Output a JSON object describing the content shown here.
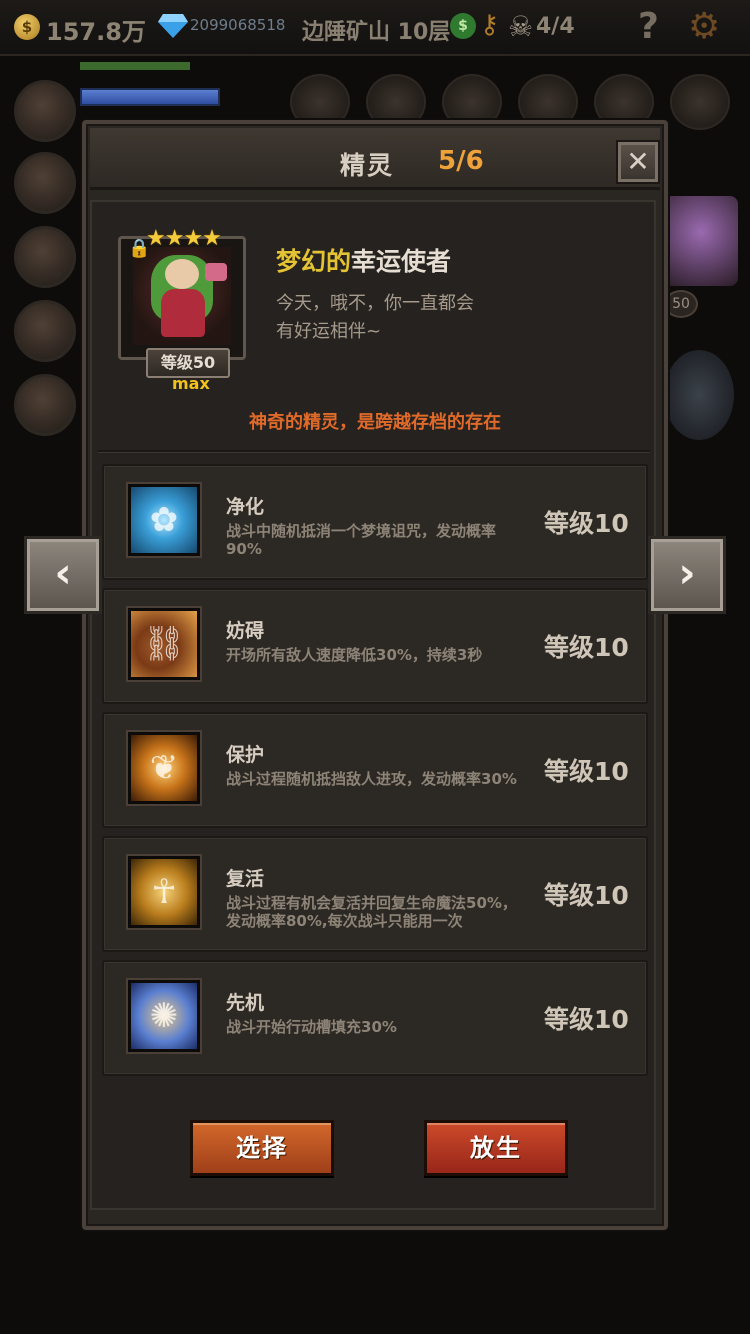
{
  "topbar": {
    "gold": "157.8万",
    "gold_icon": "$",
    "gems": "2099068518",
    "location": "边陲矿山 10层",
    "badge": "$",
    "kills": "4/4",
    "help": "?"
  },
  "background": {
    "side_level": "50"
  },
  "dialog": {
    "title": "精灵",
    "count": "5/6",
    "close": "✕"
  },
  "pet": {
    "stars": "★★★★",
    "level": "等级50",
    "max": "max",
    "name_part1": "梦幻的",
    "name_part2": "幸运使者",
    "desc_line1": "今天，哦不，你一直都会",
    "desc_line2": "有好运相伴~",
    "note": "神奇的精灵，是跨越存档的存在"
  },
  "skills": [
    {
      "name": "净化",
      "desc": "战斗中随机抵消一个梦境诅咒，发动概率90%",
      "level": "等级10",
      "icon": "flower-icon"
    },
    {
      "name": "妨碍",
      "desc": "开场所有敌人速度降低30%，持续3秒",
      "level": "等级10",
      "icon": "chained-boot-icon"
    },
    {
      "name": "保护",
      "desc": "战斗过程随机抵挡敌人进攻，发动概率30%",
      "level": "等级10",
      "icon": "fairy-icon"
    },
    {
      "name": "复活",
      "desc": "战斗过程有机会复活并回复生命魔法50%，发动概率80%,每次战斗只能用一次",
      "level": "等级10",
      "icon": "revive-figure-icon"
    },
    {
      "name": "先机",
      "desc": "战斗开始行动槽填充30%",
      "level": "等级10",
      "icon": "leopard-icon"
    }
  ],
  "buttons": {
    "select": "选择",
    "release": "放生"
  },
  "nav": {
    "prev": "‹",
    "next": "›"
  }
}
